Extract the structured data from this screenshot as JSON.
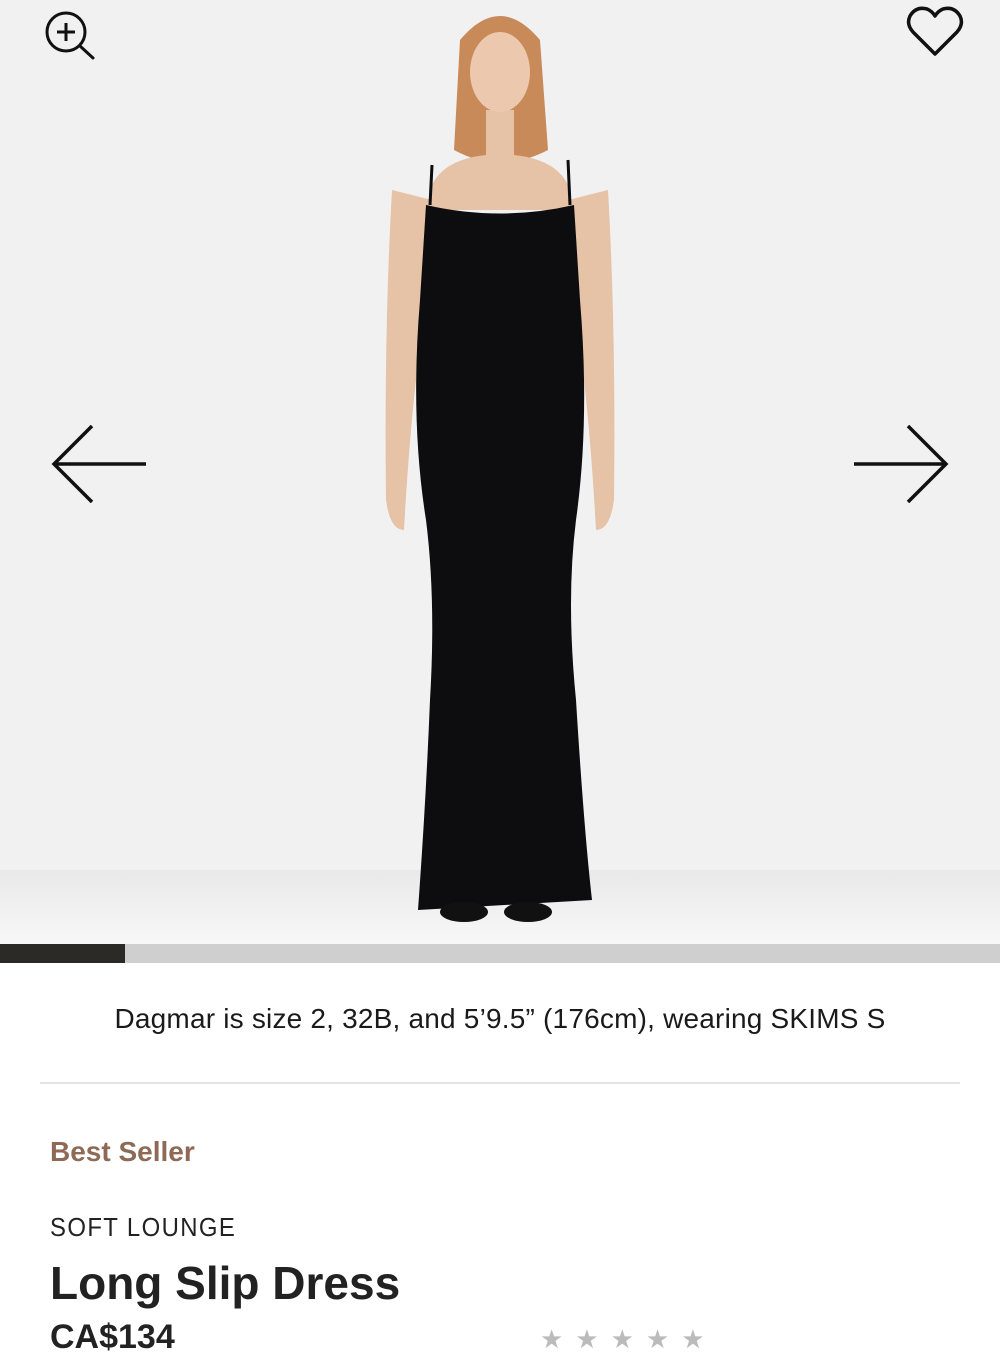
{
  "gallery": {
    "progress_fraction": 0.125,
    "icons": {
      "zoom": "zoom-in-icon",
      "favorite": "heart-outline-icon",
      "previous": "arrow-left-icon",
      "next": "arrow-right-icon"
    }
  },
  "model_info": "Dagmar is size 2, 32B, and 5’9.5” (176cm), wearing SKIMS S",
  "product": {
    "badge": "Best Seller",
    "collection": "SOFT LOUNGE",
    "name": "Long Slip Dress",
    "price": "CA$134",
    "rating_stars": "★★★★★"
  },
  "colors": {
    "badge": "#8e6a56",
    "dress": "#0d0d0f",
    "progress_active": "#2c2a27",
    "progress_track": "#cfcfcf"
  }
}
